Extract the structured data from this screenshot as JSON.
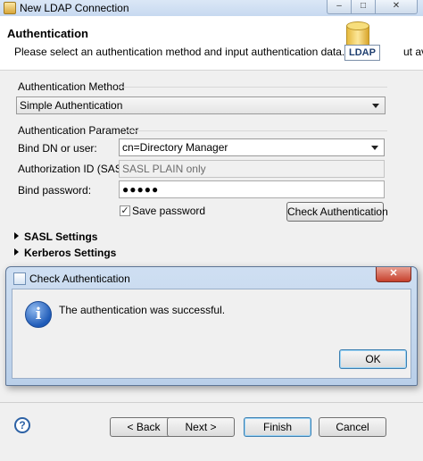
{
  "window": {
    "title": "New LDAP Connection",
    "min_glyph": "–",
    "max_glyph": "□",
    "close_glyph": "✕"
  },
  "header": {
    "title": "Authentication",
    "description": "Please select an authentication method and input authentication data.",
    "truncated_text": "ut ava",
    "icon_label": "LDAP"
  },
  "auth_method": {
    "label": "Authentication Method",
    "selected": "Simple Authentication"
  },
  "auth_param": {
    "label": "Authentication Parameter",
    "bind_dn_label": "Bind DN or user:",
    "bind_dn_value": "cn=Directory Manager",
    "authz_label": "Authorization ID (SASL):",
    "authz_value": "SASL PLAIN only",
    "password_label": "Bind password:",
    "password_value": "●●●●●",
    "save_password_label": "Save password",
    "save_password_checked": true,
    "check_auth_label": "Check Authentication"
  },
  "sections": {
    "sasl": "SASL Settings",
    "kerberos": "Kerberos Settings"
  },
  "footer": {
    "help_glyph": "?",
    "back": "< Back",
    "next": "Next >",
    "finish": "Finish",
    "cancel": "Cancel"
  },
  "dialog": {
    "title": "Check Authentication",
    "close_glyph": "✕",
    "icon_glyph": "i",
    "message": "The authentication was successful.",
    "ok": "OK"
  },
  "icons": [
    "window-app-icon",
    "ldap-icon",
    "chevron-down-icon",
    "checkmark-icon",
    "expand-triangle-icon",
    "help-icon",
    "info-icon",
    "close-icon"
  ]
}
